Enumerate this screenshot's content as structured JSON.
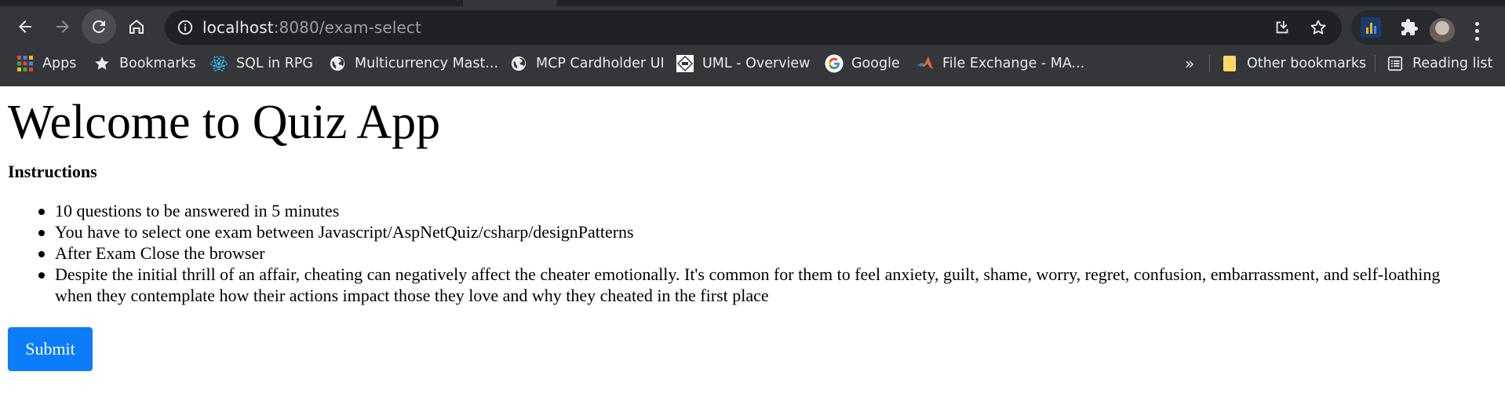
{
  "browser": {
    "url_host": "localhost",
    "url_rest": ":8080/exam-select",
    "bookmarks": [
      {
        "label": "Apps",
        "icon": "apps-grid-icon"
      },
      {
        "label": "Bookmarks",
        "icon": "star-icon"
      },
      {
        "label": "SQL in RPG",
        "icon": "react-atom-icon"
      },
      {
        "label": "Multicurrency Mast...",
        "icon": "globe-icon"
      },
      {
        "label": "MCP Cardholder UI",
        "icon": "globe-icon"
      },
      {
        "label": "UML - Overview",
        "icon": "uml-logo-icon"
      },
      {
        "label": "Google",
        "icon": "google-g-icon"
      },
      {
        "label": "File Exchange - MA...",
        "icon": "matlab-icon"
      }
    ],
    "overflow_chevron": "»",
    "other_bookmarks": "Other bookmarks",
    "reading_list": "Reading list"
  },
  "page": {
    "title": "Welcome to Quiz App",
    "instructions_heading": "Instructions",
    "instructions": [
      "10 questions to be answered in 5 minutes",
      "You have to select one exam between Javascript/AspNetQuiz/csharp/designPatterns",
      "After Exam Close the browser",
      "Despite the initial thrill of an affair, cheating can negatively affect the cheater emotionally. It's common for them to feel anxiety, guilt, shame, worry, regret, confusion, embarrassment, and self-loathing when they contemplate how their actions impact those they love and why they cheated in the first place"
    ],
    "submit_label": "Submit"
  },
  "colors": {
    "chrome_bg": "#35363a",
    "omnibox_bg": "#202124",
    "submit_bg": "#0b7dfb"
  }
}
